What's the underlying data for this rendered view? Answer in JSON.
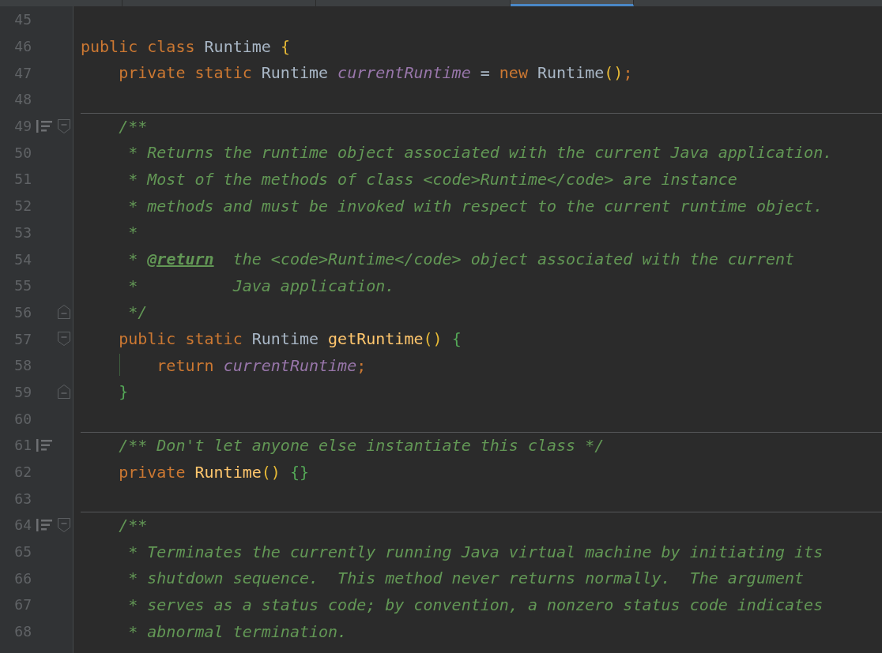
{
  "tabs": [
    {
      "selected": false
    },
    {
      "selected": false
    },
    {
      "selected": false
    },
    {
      "selected": true
    }
  ],
  "lines": [
    {
      "number": "45"
    },
    {
      "number": "46",
      "tokens": [
        {
          "kind": "keyword",
          "text": "public class "
        },
        {
          "kind": "plain",
          "text": "Runtime "
        },
        {
          "kind": "bracket-gold",
          "text": "{"
        }
      ]
    },
    {
      "number": "47",
      "tokens": [
        {
          "kind": "keyword",
          "text": "    private static "
        },
        {
          "kind": "plain",
          "text": "Runtime "
        },
        {
          "kind": "field",
          "text": "currentRuntime"
        },
        {
          "kind": "plain",
          "text": " = "
        },
        {
          "kind": "keyword",
          "text": "new "
        },
        {
          "kind": "plain",
          "text": "Runtime"
        },
        {
          "kind": "bracket-gold",
          "text": "()"
        },
        {
          "kind": "keyword",
          "text": ";"
        }
      ]
    },
    {
      "number": "48"
    },
    {
      "number": "49",
      "separator_above": true,
      "doc_icon": true,
      "fold_start": true,
      "tokens": [
        {
          "kind": "doc",
          "text": "    /**"
        }
      ]
    },
    {
      "number": "50",
      "tokens": [
        {
          "kind": "doc",
          "text": "     * Returns the runtime object associated with the current Java application."
        }
      ]
    },
    {
      "number": "51",
      "tokens": [
        {
          "kind": "doc",
          "text": "     * Most of the methods of class <code>Runtime</code> are instance"
        }
      ]
    },
    {
      "number": "52",
      "tokens": [
        {
          "kind": "doc",
          "text": "     * methods and must be invoked with respect to the current runtime object."
        }
      ]
    },
    {
      "number": "53",
      "tokens": [
        {
          "kind": "doc",
          "text": "     *"
        }
      ]
    },
    {
      "number": "54",
      "tokens": [
        {
          "kind": "doc",
          "text": "     * "
        },
        {
          "kind": "doc-tag",
          "text": "@return"
        },
        {
          "kind": "doc",
          "text": "  the <code>Runtime</code> object associated with the current"
        }
      ]
    },
    {
      "number": "55",
      "tokens": [
        {
          "kind": "doc",
          "text": "     *          Java application."
        }
      ]
    },
    {
      "number": "56",
      "fold_end": true,
      "tokens": [
        {
          "kind": "doc",
          "text": "     */"
        }
      ]
    },
    {
      "number": "57",
      "fold_start": true,
      "tokens": [
        {
          "kind": "keyword",
          "text": "    public static "
        },
        {
          "kind": "plain",
          "text": "Runtime "
        },
        {
          "kind": "method",
          "text": "getRuntime"
        },
        {
          "kind": "bracket-gold",
          "text": "() "
        },
        {
          "kind": "bracket-green",
          "text": "{"
        }
      ]
    },
    {
      "number": "58",
      "guide": true,
      "tokens": [
        {
          "kind": "keyword",
          "text": "        return "
        },
        {
          "kind": "field",
          "text": "currentRuntime"
        },
        {
          "kind": "keyword",
          "text": ";"
        }
      ]
    },
    {
      "number": "59",
      "fold_end": true,
      "tokens": [
        {
          "kind": "bracket-green",
          "text": "    }"
        }
      ]
    },
    {
      "number": "60"
    },
    {
      "number": "61",
      "separator_above": true,
      "doc_icon": true,
      "tokens": [
        {
          "kind": "doc",
          "text": "    /** Don't let anyone else instantiate this class */"
        }
      ]
    },
    {
      "number": "62",
      "tokens": [
        {
          "kind": "keyword",
          "text": "    private "
        },
        {
          "kind": "method",
          "text": "Runtime"
        },
        {
          "kind": "bracket-gold",
          "text": "() "
        },
        {
          "kind": "bracket-green",
          "text": "{}"
        }
      ]
    },
    {
      "number": "63"
    },
    {
      "number": "64",
      "separator_above": true,
      "doc_icon": true,
      "fold_start": true,
      "tokens": [
        {
          "kind": "doc",
          "text": "    /**"
        }
      ]
    },
    {
      "number": "65",
      "tokens": [
        {
          "kind": "doc",
          "text": "     * Terminates the currently running Java virtual machine by initiating its"
        }
      ]
    },
    {
      "number": "66",
      "tokens": [
        {
          "kind": "doc",
          "text": "     * shutdown sequence.  This method never returns normally.  The argument"
        }
      ]
    },
    {
      "number": "67",
      "tokens": [
        {
          "kind": "doc",
          "text": "     * serves as a status code; by convention, a nonzero status code indicates"
        }
      ]
    },
    {
      "number": "68",
      "tokens": [
        {
          "kind": "doc",
          "text": "     * abnormal termination."
        }
      ]
    }
  ]
}
